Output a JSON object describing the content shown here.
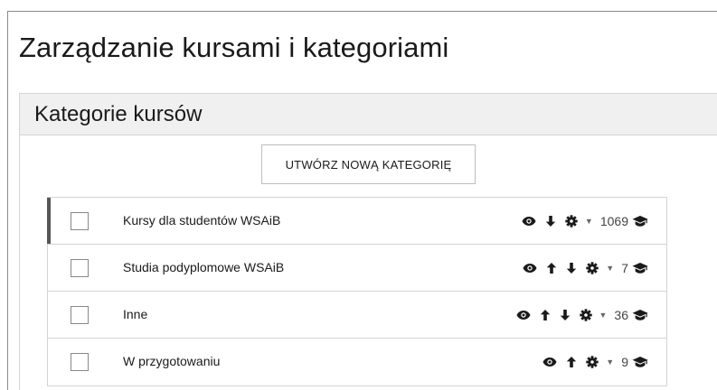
{
  "page": {
    "title": "Zarządzanie kursami i kategoriami"
  },
  "panel": {
    "title": "Kategorie kursów",
    "create_button": "UTWÓRZ NOWĄ KATEGORIĘ"
  },
  "categories": [
    {
      "name": "Kursy dla studentów WSAiB",
      "count": "1069",
      "icons": [
        "eye-icon",
        "arrow-down-icon",
        "gear-icon"
      ],
      "active": true
    },
    {
      "name": "Studia podyplomowe WSAiB",
      "count": "7",
      "icons": [
        "eye-icon",
        "arrow-up-icon",
        "arrow-down-icon",
        "gear-icon"
      ],
      "active": false
    },
    {
      "name": "Inne",
      "count": "36",
      "icons": [
        "eye-icon",
        "arrow-up-icon",
        "arrow-down-icon",
        "gear-icon"
      ],
      "active": false
    },
    {
      "name": "W przygotowaniu",
      "count": "9",
      "icons": [
        "eye-icon",
        "arrow-up-icon",
        "gear-icon"
      ],
      "active": false
    }
  ],
  "colors": {
    "accent_bar": "#555555",
    "header_bg": "#f0f0f0",
    "border": "#d4d4d4"
  }
}
